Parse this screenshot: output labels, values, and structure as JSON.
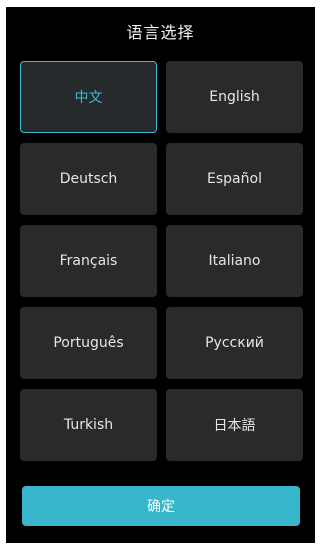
{
  "title": "语言选择",
  "languages": [
    {
      "label": "中文",
      "selected": true
    },
    {
      "label": "English",
      "selected": false
    },
    {
      "label": "Deutsch",
      "selected": false
    },
    {
      "label": "Español",
      "selected": false
    },
    {
      "label": "Français",
      "selected": false
    },
    {
      "label": "Italiano",
      "selected": false
    },
    {
      "label": "Português",
      "selected": false
    },
    {
      "label": "Русский",
      "selected": false
    },
    {
      "label": "Turkish",
      "selected": false
    },
    {
      "label": "日本語",
      "selected": false
    }
  ],
  "confirm_label": "确定",
  "colors": {
    "accent": "#37bcd3",
    "button_bg": "#2a2a2a",
    "screen_bg": "#000000"
  }
}
